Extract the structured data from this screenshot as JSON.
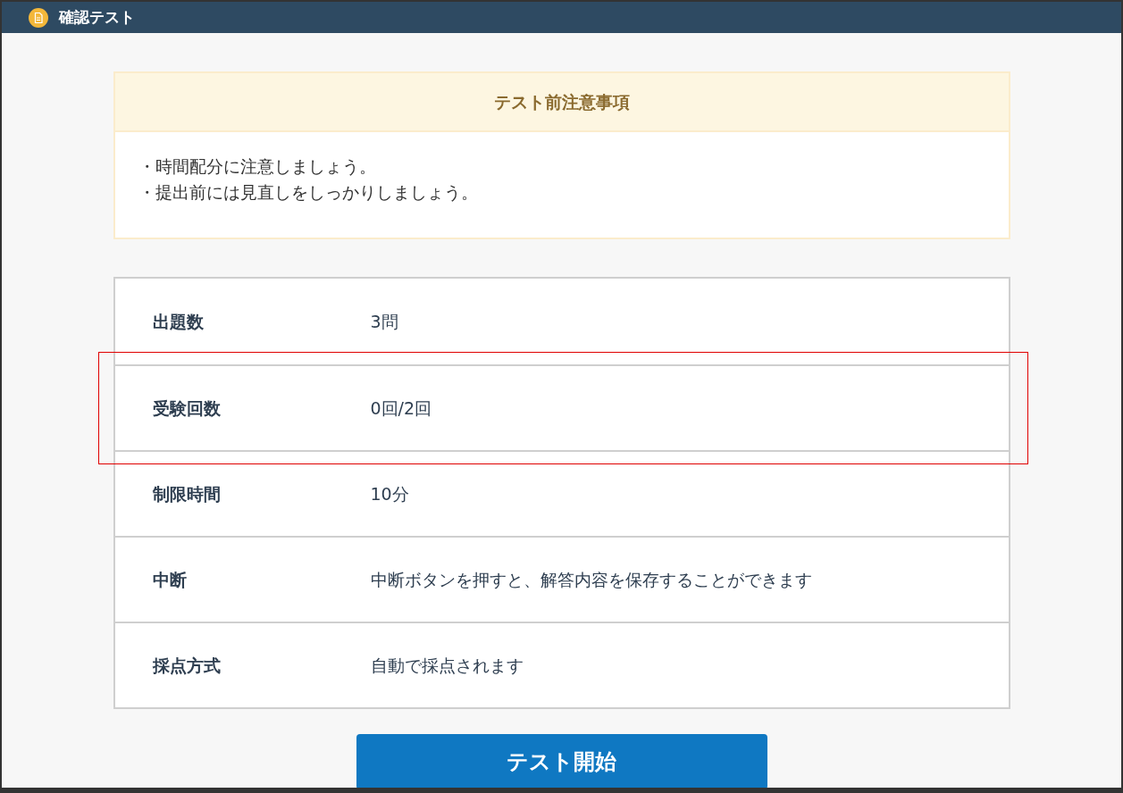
{
  "window": {
    "title": "確認テスト"
  },
  "notice": {
    "title": "テスト前注意事項",
    "lines": [
      "・時間配分に注意しましょう。",
      "・提出前には見直しをしっかりしましょう。"
    ]
  },
  "table": {
    "rows": [
      {
        "label": "出題数",
        "value": "3問",
        "highlighted": false
      },
      {
        "label": "受験回数",
        "value": "0回/2回",
        "highlighted": true
      },
      {
        "label": "制限時間",
        "value": "10分",
        "highlighted": false
      },
      {
        "label": "中断",
        "value": "中断ボタンを押すと、解答内容を保存することができます",
        "highlighted": false
      },
      {
        "label": "採点方式",
        "value": "自動で採点されます",
        "highlighted": false
      }
    ]
  },
  "start_button": {
    "label": "テスト開始"
  }
}
